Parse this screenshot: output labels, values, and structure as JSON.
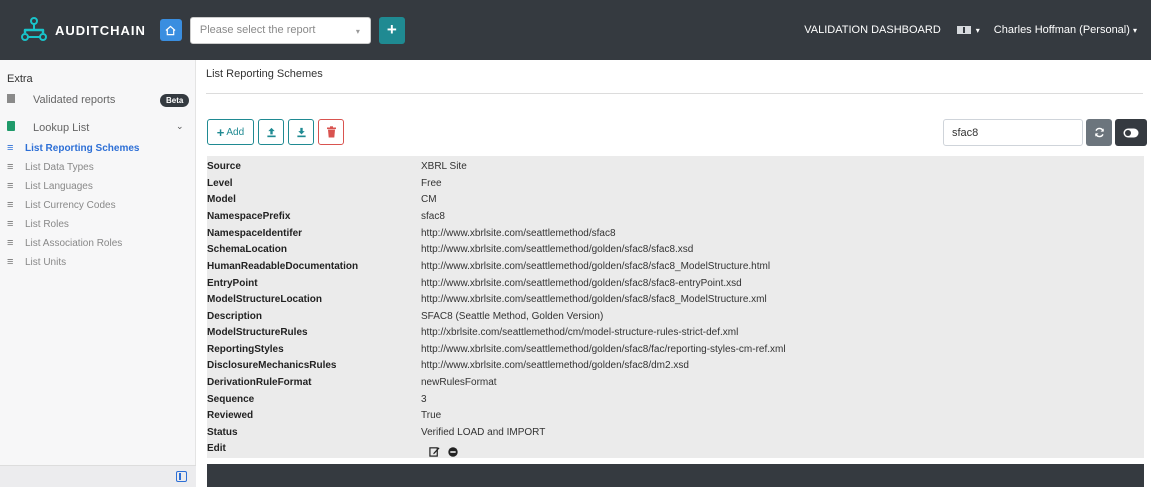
{
  "header": {
    "brand": "AUDITCHAIN",
    "report_placeholder": "Please select the report",
    "dashboard_label": "VALIDATION DASHBOARD",
    "user_label": "Charles Hoffman (Personal)",
    "colors": {
      "bar": "#353a40",
      "home": "#3a8ee0",
      "teal": "#1f8a92"
    }
  },
  "sidebar": {
    "heading": "Extra",
    "validated_reports": "Validated reports",
    "beta_badge": "Beta",
    "lookup_list": "Lookup List",
    "items": [
      {
        "label": "List Reporting Schemes",
        "active": true
      },
      {
        "label": "List Data Types",
        "active": false
      },
      {
        "label": "List Languages",
        "active": false
      },
      {
        "label": "List Currency Codes",
        "active": false
      },
      {
        "label": "List Roles",
        "active": false
      },
      {
        "label": "List Association Roles",
        "active": false
      },
      {
        "label": "List Units",
        "active": false
      }
    ]
  },
  "main": {
    "title": "List Reporting Schemes",
    "add_label": "Add",
    "search_value": "sfac8",
    "details": [
      {
        "key": "Source",
        "value": "XBRL Site"
      },
      {
        "key": "Level",
        "value": "Free"
      },
      {
        "key": "Model",
        "value": "CM"
      },
      {
        "key": "NamespacePrefix",
        "value": "sfac8"
      },
      {
        "key": "NamespaceIdentifer",
        "value": "http://www.xbrlsite.com/seattlemethod/sfac8"
      },
      {
        "key": "SchemaLocation",
        "value": "http://www.xbrlsite.com/seattlemethod/golden/sfac8/sfac8.xsd"
      },
      {
        "key": "HumanReadableDocumentation",
        "value": "http://www.xbrlsite.com/seattlemethod/golden/sfac8/sfac8_ModelStructure.html"
      },
      {
        "key": "EntryPoint",
        "value": "http://www.xbrlsite.com/seattlemethod/golden/sfac8/sfac8-entryPoint.xsd"
      },
      {
        "key": "ModelStructureLocation",
        "value": "http://www.xbrlsite.com/seattlemethod/golden/sfac8/sfac8_ModelStructure.xml"
      },
      {
        "key": "Description",
        "value": "SFAC8 (Seattle Method, Golden Version)"
      },
      {
        "key": "ModelStructureRules",
        "value": "http://xbrlsite.com/seattlemethod/cm/model-structure-rules-strict-def.xml"
      },
      {
        "key": "ReportingStyles",
        "value": "http://www.xbrlsite.com/seattlemethod/golden/sfac8/fac/reporting-styles-cm-ref.xml"
      },
      {
        "key": "DisclosureMechanicsRules",
        "value": "http://www.xbrlsite.com/seattlemethod/golden/sfac8/dm2.xsd"
      },
      {
        "key": "DerivationRuleFormat",
        "value": "newRulesFormat"
      },
      {
        "key": "Sequence",
        "value": "3"
      },
      {
        "key": "Reviewed",
        "value": "True"
      },
      {
        "key": "Status",
        "value": "Verified LOAD and IMPORT"
      },
      {
        "key": "Edit",
        "value": ""
      }
    ]
  }
}
